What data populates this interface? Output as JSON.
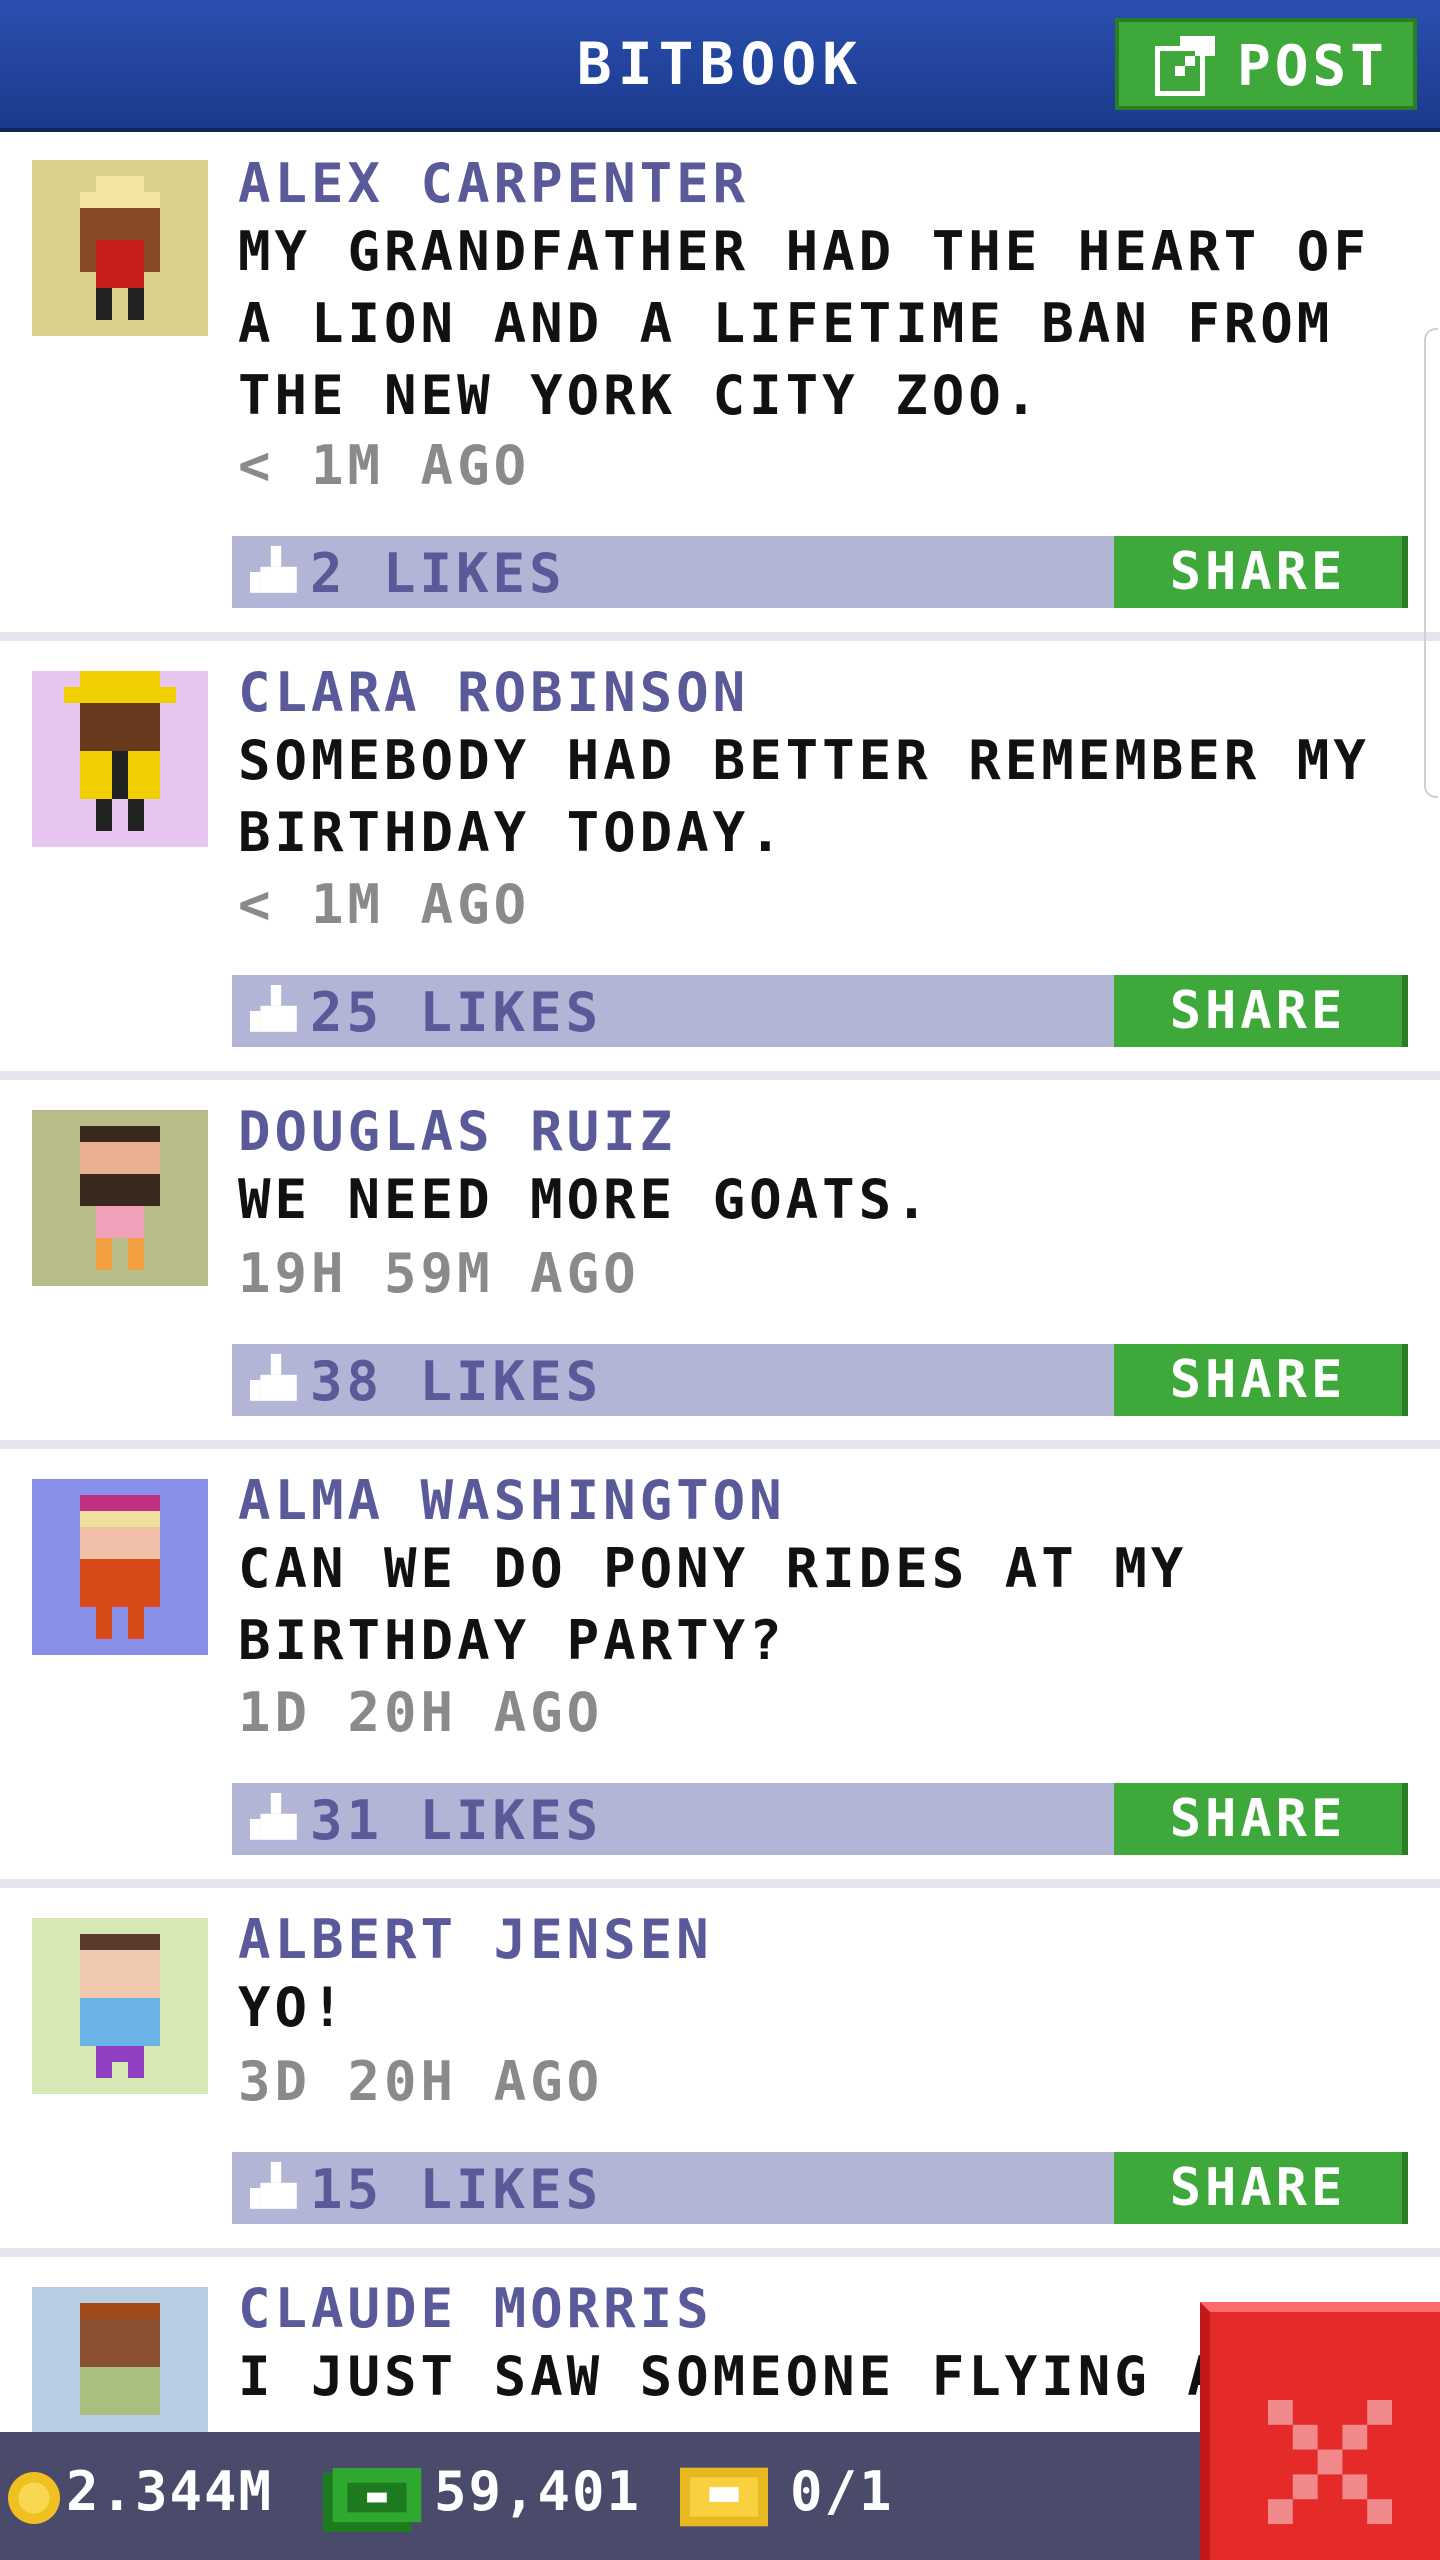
{
  "header": {
    "title": "BITBOOK",
    "post_label": "POST"
  },
  "posts": [
    {
      "author": "ALEX CARPENTER",
      "message": "MY GRANDFATHER HAD THE HEART OF A LION AND A LIFETIME BAN FROM THE NEW YORK CITY ZOO.",
      "time": "< 1M AGO",
      "likes": "2 LIKES",
      "share": "SHARE",
      "avatar_bg": "#d9d08a"
    },
    {
      "author": "CLARA ROBINSON",
      "message": "SOMEBODY HAD BETTER REMEMBER MY BIRTHDAY TODAY.",
      "time": "< 1M AGO",
      "likes": "25 LIKES",
      "share": "SHARE",
      "avatar_bg": "#e6c6ee"
    },
    {
      "author": "DOUGLAS RUIZ",
      "message": "WE NEED MORE GOATS.",
      "time": "19H 59M AGO",
      "likes": "38 LIKES",
      "share": "SHARE",
      "avatar_bg": "#b8bc88"
    },
    {
      "author": "ALMA WASHINGTON",
      "message": "CAN WE DO PONY RIDES AT MY BIRTHDAY PARTY?",
      "time": "1D 20H AGO",
      "likes": "31 LIKES",
      "share": "SHARE",
      "avatar_bg": "#8890e8"
    },
    {
      "author": "ALBERT JENSEN",
      "message": "YO!",
      "time": "3D 20H AGO",
      "likes": "15 LIKES",
      "share": "SHARE",
      "avatar_bg": "#d6e8b4"
    },
    {
      "author": "CLAUDE MORRIS",
      "message": "I JUST SAW SOMEONE FLYING A",
      "avatar_bg": "#b8cce4"
    }
  ],
  "footer": {
    "coins": "2.344M",
    "bux": "59,401",
    "tickets": "0/1"
  },
  "colors": {
    "header": "#1b3a8c",
    "accent_green": "#3fa83a",
    "like_bar": "#b3b5d6",
    "close_red": "#e52a2a"
  }
}
